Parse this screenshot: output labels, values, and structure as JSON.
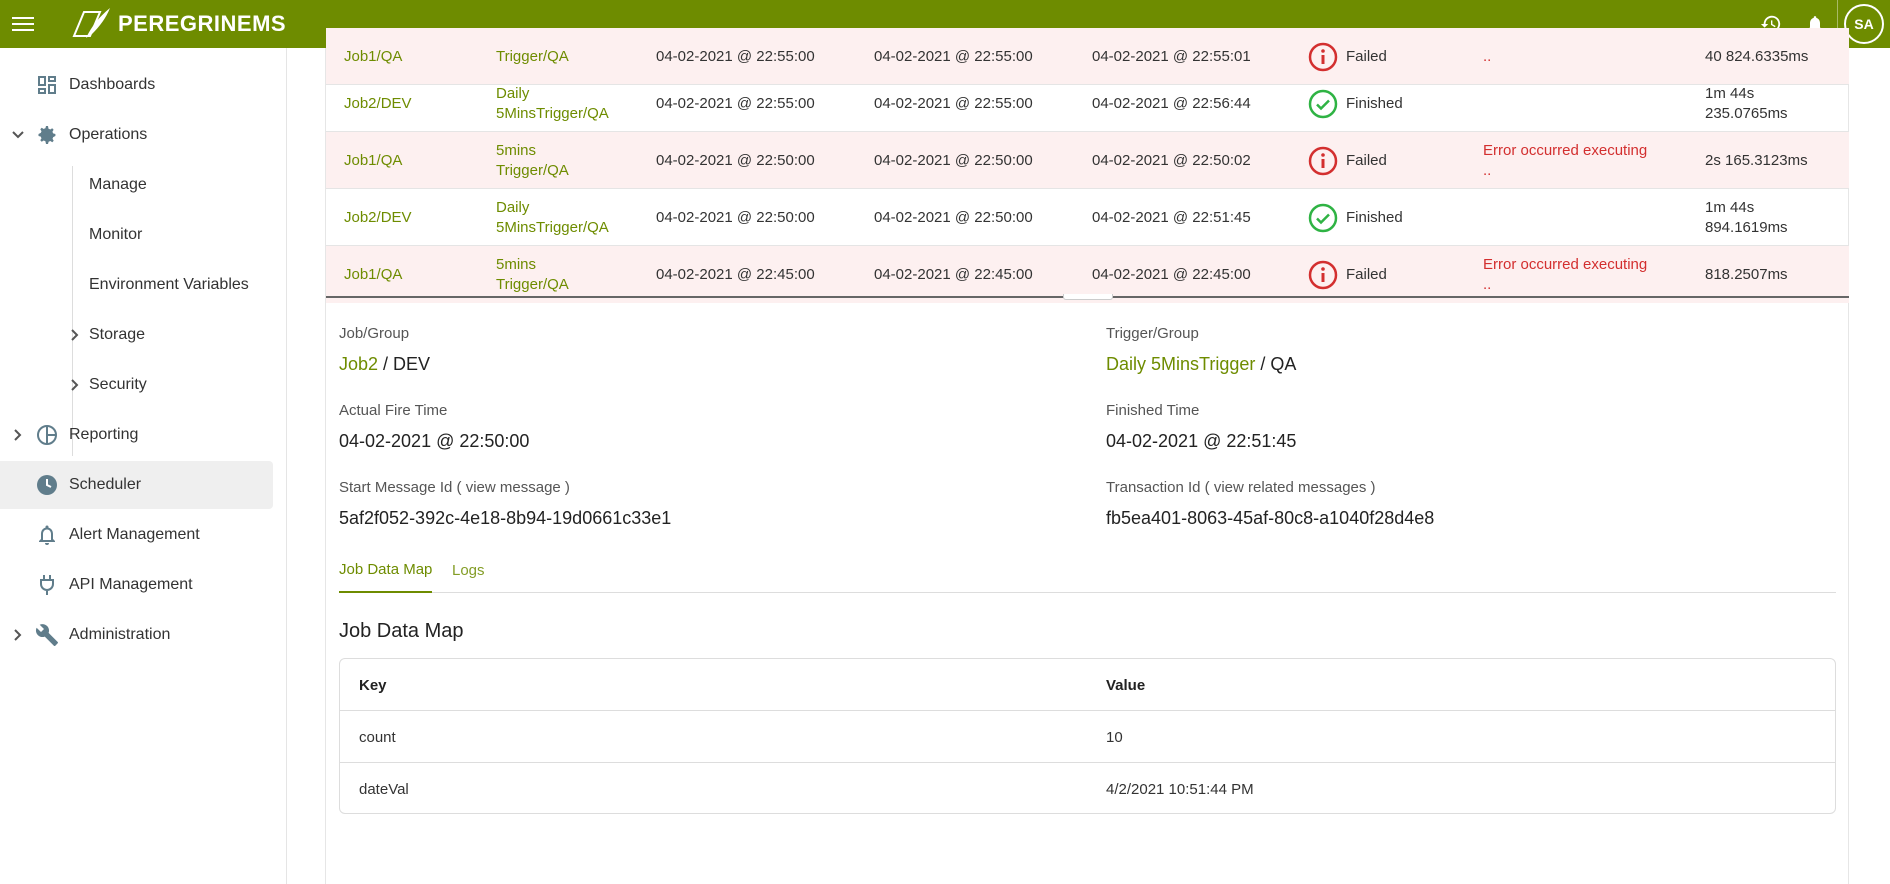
{
  "app": {
    "brand": "PEREGRINEMS",
    "user_initials": "SA",
    "colors": {
      "brand": "#6e8c00",
      "failed_bg": "#fdf0f0",
      "error": "#d32f2f",
      "success": "#2fb344"
    }
  },
  "topbar": {
    "icons": [
      "history-icon",
      "bell-icon"
    ]
  },
  "sidebar": {
    "items": [
      {
        "label": "Dashboards",
        "icon": "dashboard-icon"
      },
      {
        "label": "Operations",
        "icon": "gear-icon",
        "expanded": true
      },
      {
        "label": "Reporting",
        "icon": "chart-icon"
      },
      {
        "label": "Scheduler",
        "icon": "clock-icon",
        "active": true
      },
      {
        "label": "Alert Management",
        "icon": "bell-icon"
      },
      {
        "label": "API Management",
        "icon": "plug-icon"
      },
      {
        "label": "Administration",
        "icon": "wrench-icon"
      }
    ],
    "sub_items": [
      {
        "label": "Manage"
      },
      {
        "label": "Monitor"
      },
      {
        "label": "Environment Variables"
      },
      {
        "label": "Storage"
      },
      {
        "label": "Security"
      }
    ]
  },
  "history": {
    "rows": [
      {
        "job": "Job1/QA",
        "trigger_line1": "",
        "trigger_line2": "Trigger/QA",
        "scheduled": "04-02-2021 @ 22:55:00",
        "fired": "04-02-2021 @ 22:55:00",
        "finished": "04-02-2021 @ 22:55:01",
        "status": "Failed",
        "error_line1": "",
        "error_line2": "..",
        "duration_line1": "",
        "duration_line2": "40 824.6335ms"
      },
      {
        "job": "Job2/DEV",
        "trigger_line1": "Daily",
        "trigger_line2": "5MinsTrigger/QA",
        "scheduled": "04-02-2021 @ 22:55:00",
        "fired": "04-02-2021 @ 22:55:00",
        "finished": "04-02-2021 @ 22:56:44",
        "status": "Finished",
        "error_line1": "",
        "error_line2": "",
        "duration_line1": "1m 44s",
        "duration_line2": "235.0765ms"
      },
      {
        "job": "Job1/QA",
        "trigger_line1": "5mins",
        "trigger_line2": "Trigger/QA",
        "scheduled": "04-02-2021 @ 22:50:00",
        "fired": "04-02-2021 @ 22:50:00",
        "finished": "04-02-2021 @ 22:50:02",
        "status": "Failed",
        "error_line1": "Error occurred executing",
        "error_line2": "..",
        "duration_line1": "2s 165.3123ms",
        "duration_line2": ""
      },
      {
        "job": "Job2/DEV",
        "trigger_line1": "Daily",
        "trigger_line2": "5MinsTrigger/QA",
        "scheduled": "04-02-2021 @ 22:50:00",
        "fired": "04-02-2021 @ 22:50:00",
        "finished": "04-02-2021 @ 22:51:45",
        "status": "Finished",
        "error_line1": "",
        "error_line2": "",
        "duration_line1": "1m 44s",
        "duration_line2": "894.1619ms"
      },
      {
        "job": "Job1/QA",
        "trigger_line1": "5mins",
        "trigger_line2": "Trigger/QA",
        "scheduled": "04-02-2021 @ 22:45:00",
        "fired": "04-02-2021 @ 22:45:00",
        "finished": "04-02-2021 @ 22:45:00",
        "status": "Failed",
        "error_line1": "Error occurred executing",
        "error_line2": "..",
        "duration_line1": "818.2507ms",
        "duration_line2": ""
      }
    ]
  },
  "detail": {
    "job_group_label": "Job/Group",
    "job_name": "Job2",
    "job_group": " / DEV",
    "trigger_group_label": "Trigger/Group",
    "trigger_name": "Daily 5MinsTrigger",
    "trigger_group": " / QA",
    "actual_fire_label": "Actual Fire Time",
    "actual_fire_value": "04-02-2021 @ 22:50:00",
    "finished_label": "Finished Time",
    "finished_value": "04-02-2021 @ 22:51:45",
    "start_msg_label": "Start Message Id ( view message )",
    "start_msg_value": "5af2f052-392c-4e18-8b94-19d0661c33e1",
    "transaction_label": "Transaction Id ( view related messages )",
    "transaction_value": "fb5ea401-8063-45af-80c8-a1040f28d4e8"
  },
  "tabs": {
    "job_data_map": "Job Data Map",
    "logs": "Logs"
  },
  "job_data_map": {
    "title": "Job Data Map",
    "key_header": "Key",
    "value_header": "Value",
    "rows": [
      {
        "key": "count",
        "value": "10"
      },
      {
        "key": "dateVal",
        "value": "4/2/2021 10:51:44 PM"
      }
    ]
  }
}
